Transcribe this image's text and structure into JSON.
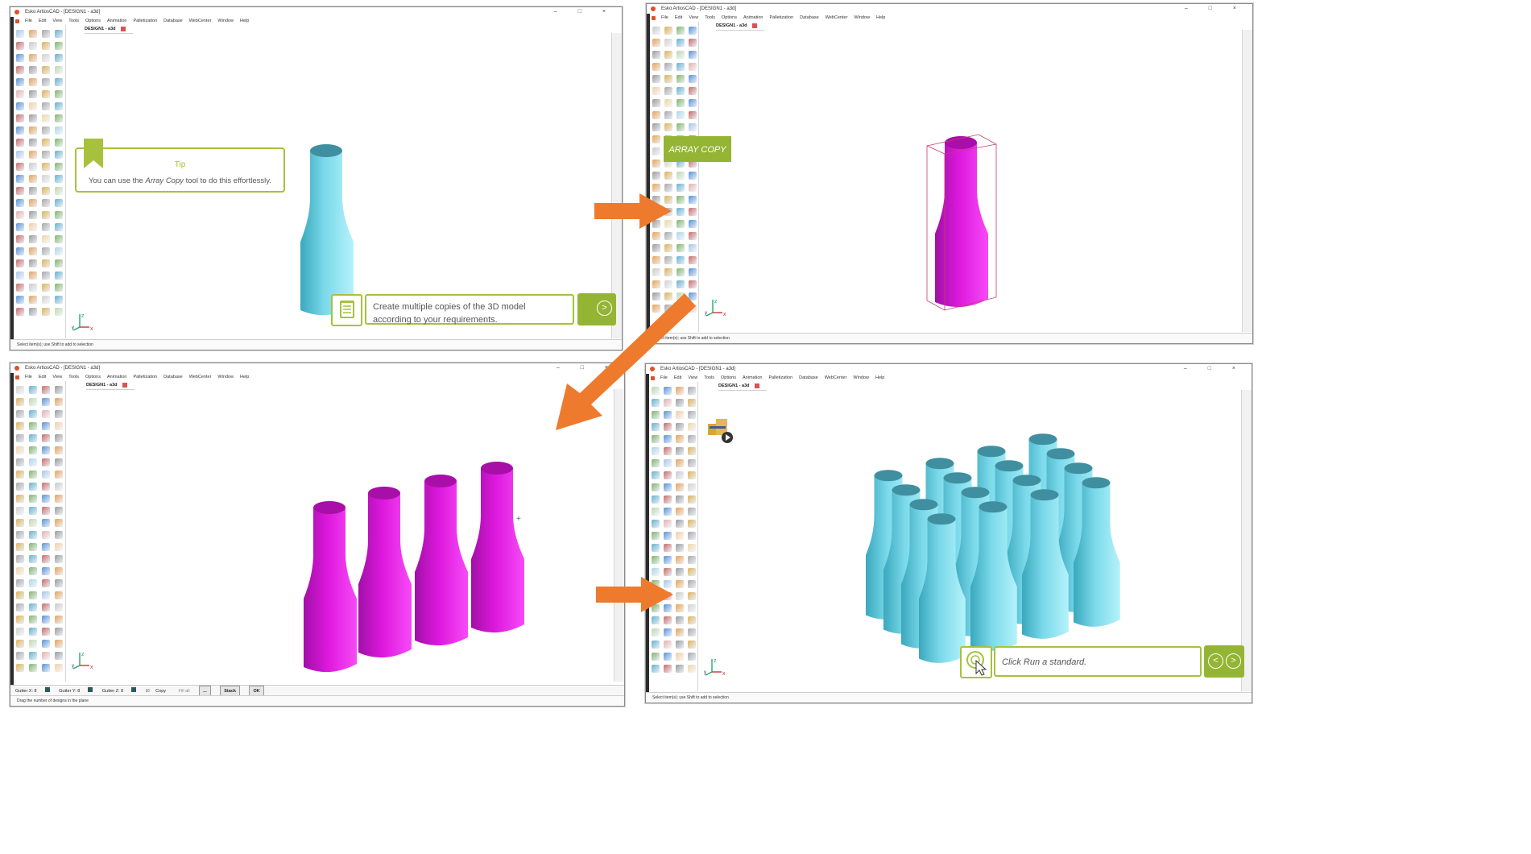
{
  "app": {
    "window_title": "Esko ArtiosCAD - [DESIGN1 - a3d]",
    "tab_label": "DESIGN1 - a3d",
    "menu": [
      "File",
      "Edit",
      "View",
      "Tools",
      "Options",
      "Animation",
      "Palletization",
      "Database",
      "WebCenter",
      "Window",
      "Help"
    ],
    "status_select": "Select item(s); use Shift to add to selection",
    "status_drag": "Drag the number of designs in the plane"
  },
  "panel1": {
    "tip_title": "Tip",
    "tip_text_before": "You can use the ",
    "tip_text_em": "Array Copy",
    "tip_text_after": " tool to do this effortlessly.",
    "prompt_text": "Create multiple copies of the 3D model according to your requirements.",
    "next_symbol": ">"
  },
  "panel2": {
    "tool_label": "ARRAY COPY"
  },
  "panel3": {
    "gutter_x": "Gutter X: 8",
    "gutter_y": "Gutter Y: 8",
    "gutter_z": "Gutter Z: 8",
    "copy_label": "Copy",
    "fill_all_label": "Fill all",
    "more_label": "...",
    "stack_label": "Stack",
    "ok_label": "OK"
  },
  "panel4": {
    "prompt_text_before": "Click ",
    "prompt_text_em": "Run a standard",
    "prompt_text_after": ".",
    "prev_symbol": "<",
    "next_symbol": ">"
  },
  "colors": {
    "accent_green": "#94b534",
    "tip_green": "#a6c23c",
    "arrow_orange": "#ee7a2e",
    "bottle_cyan": "#8fe8f4",
    "bottle_magenta": "#e81de8"
  }
}
